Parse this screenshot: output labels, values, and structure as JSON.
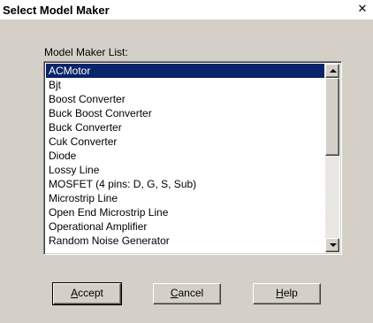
{
  "window": {
    "title": "Select Model Maker",
    "close_glyph": "✕"
  },
  "list": {
    "label": "Model Maker List:",
    "selected_index": 0,
    "items": [
      "ACMotor",
      "Bjt",
      "Boost Converter",
      "Buck Boost Converter",
      "Buck Converter",
      "Cuk Converter",
      "Diode",
      "Lossy Line",
      "MOSFET (4 pins: D, G, S, Sub)",
      "Microstrip Line",
      "Open End Microstrip Line",
      "Operational Amplifier",
      "Random Noise Generator"
    ]
  },
  "buttons": {
    "accept": {
      "mnemonic": "A",
      "rest": "ccept"
    },
    "cancel": {
      "mnemonic": "C",
      "rest": "ancel"
    },
    "help": {
      "mnemonic": "H",
      "rest": "elp"
    }
  },
  "colors": {
    "selection": "#0a246a",
    "face": "#d4d0c8"
  },
  "icons": {
    "close": "close-icon",
    "scroll_up": "scroll-up-arrow-icon",
    "scroll_down": "scroll-down-arrow-icon"
  }
}
